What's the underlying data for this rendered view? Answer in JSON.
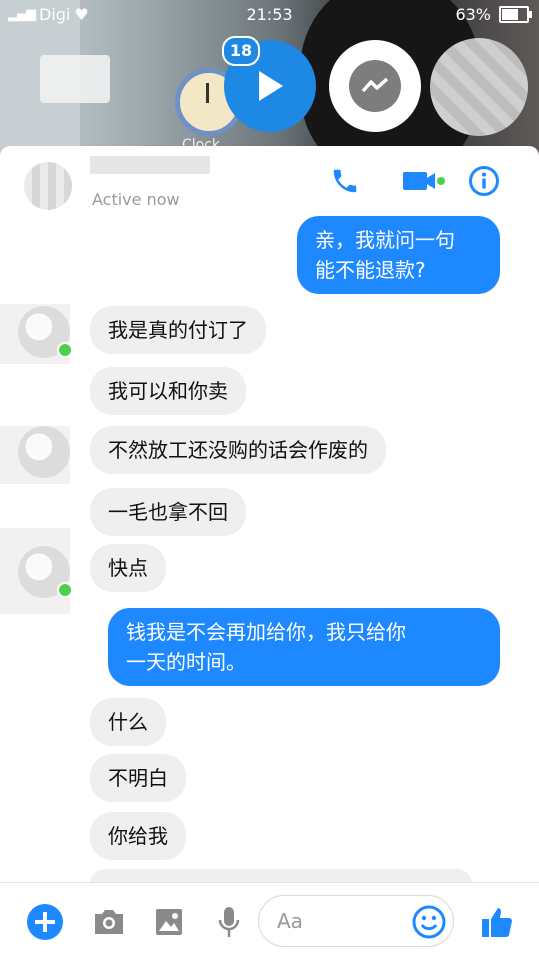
{
  "status_bar": {
    "carrier": "Digi",
    "time": "21:53",
    "battery": "63%"
  },
  "chat_heads": {
    "badge_count": "18",
    "background_label": "Clock"
  },
  "header": {
    "status": "Active now"
  },
  "messages": [
    {
      "dir": "out",
      "text": "亲，我就问一句\n能不能退款?"
    },
    {
      "dir": "in",
      "text": "我是真的付订了"
    },
    {
      "dir": "in",
      "text": "我可以和你卖"
    },
    {
      "dir": "in",
      "text": "不然放工还没购的话会作废的"
    },
    {
      "dir": "in",
      "text": "一毛也拿不回"
    },
    {
      "dir": "in",
      "text": "快点"
    },
    {
      "dir": "out",
      "text": "钱我是不会再加给你，我只给你\n一天的时间。"
    },
    {
      "dir": "in",
      "text": "什么"
    },
    {
      "dir": "in",
      "text": "不明白"
    },
    {
      "dir": "in",
      "text": "你给我"
    }
  ],
  "composer": {
    "placeholder": "Aa"
  },
  "colors": {
    "accent": "#1e88ff",
    "incoming_bubble": "#efefef",
    "online": "#4cd04c"
  }
}
